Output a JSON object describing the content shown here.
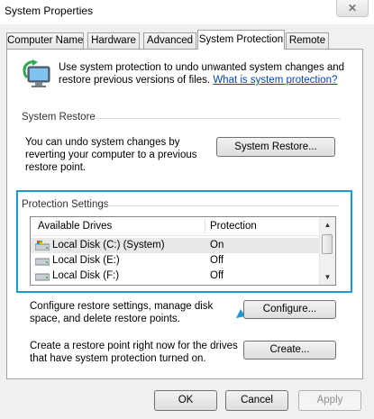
{
  "window": {
    "title": "System Properties",
    "close_glyph": "✕"
  },
  "tabs": [
    {
      "label": "Computer Name"
    },
    {
      "label": "Hardware"
    },
    {
      "label": "Advanced"
    },
    {
      "label": "System Protection",
      "active": true
    },
    {
      "label": "Remote"
    }
  ],
  "intro": {
    "text": "Use system protection to undo unwanted system changes and restore previous versions of files.",
    "link": "What is system protection?"
  },
  "system_restore": {
    "group_label": "System Restore",
    "description": "You can undo system changes by reverting your computer to a previous restore point.",
    "button": "System Restore..."
  },
  "protection": {
    "group_label": "Protection Settings",
    "columns": [
      "Available Drives",
      "Protection"
    ],
    "drives": [
      {
        "name": "Local Disk (C:) (System)",
        "status": "On",
        "icon": "system-drive-icon"
      },
      {
        "name": "Local Disk (E:)",
        "status": "Off",
        "icon": "disk-drive-icon"
      },
      {
        "name": "Local Disk (F:)",
        "status": "Off",
        "icon": "disk-drive-icon"
      }
    ]
  },
  "configure": {
    "description": "Configure restore settings, manage disk space, and delete restore points.",
    "button": "Configure..."
  },
  "create": {
    "description": "Create a restore point right now for the drives that have system protection turned on.",
    "button": "Create..."
  },
  "footer": {
    "ok": "OK",
    "cancel": "Cancel",
    "apply": "Apply"
  },
  "colors": {
    "highlight": "#1b9ad6",
    "link": "#0645ad",
    "arrow": "#1b9ad6"
  }
}
